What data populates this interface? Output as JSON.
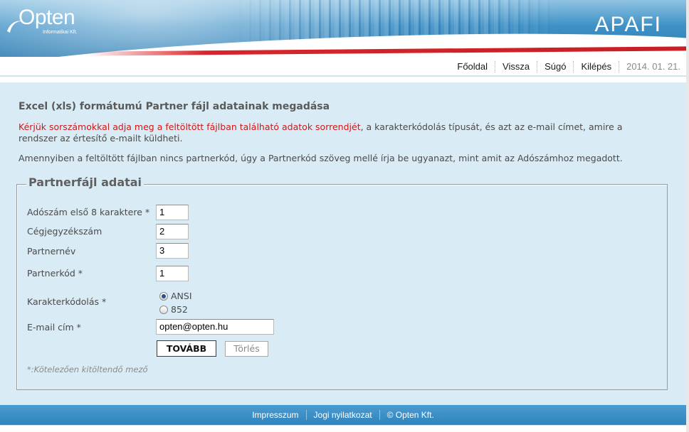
{
  "brand": {
    "logo_text": "Opten",
    "logo_subtitle": "Informatikai Kft.",
    "app_name": "APAFI"
  },
  "topnav": {
    "items": [
      {
        "label": "Főoldal"
      },
      {
        "label": "Vissza"
      },
      {
        "label": "Súgó"
      },
      {
        "label": "Kilépés"
      }
    ],
    "date": "2014. 01. 21."
  },
  "main": {
    "title": "Excel (xls) formátumú Partner fájl adatainak megadása",
    "intro_red": "Kérjük sorszámokkal adja meg a feltöltött fájlban található adatok sorrendjét",
    "intro_rest": ", a karakterkódolás típusát, és azt az e-mail címet, amire a rendszer az értesítő e-mailt küldheti.",
    "intro2": "Amennyiben a feltöltött fájlban nincs partnerkód, úgy a Partnerkód szöveg mellé írja be ugyanazt, mint amit az Adószámhoz megadott."
  },
  "form": {
    "legend": "Partnerfájl adatai",
    "fields": {
      "adoszam": {
        "label": "Adószám első 8 karaktere *",
        "value": "1"
      },
      "cegjegyzekszam": {
        "label": "Cégjegyzékszám",
        "value": "2"
      },
      "partnernev": {
        "label": "Partnernév",
        "value": "3"
      },
      "partnerkod": {
        "label": "Partnerkód *",
        "value": "1"
      },
      "karakterkodolas": {
        "label": "Karakterkódolás *",
        "options": [
          {
            "label": "ANSI",
            "checked": true
          },
          {
            "label": "852",
            "checked": false
          }
        ]
      },
      "email": {
        "label": "E-mail cím *",
        "value": "opten@opten.hu"
      }
    },
    "next_label": "TOVÁBB",
    "clear_label": "Törlés",
    "required_note": "*:Kötelezően kitöltendő mező"
  },
  "footer": {
    "items": [
      {
        "label": "Impresszum"
      },
      {
        "label": "Jogi nyilatkozat"
      },
      {
        "label": "© Opten Kft."
      }
    ]
  },
  "colors": {
    "header_blue": "#3f91c6",
    "accent_red": "#d8252b",
    "content_bg": "#d9ebf5",
    "footer_blue": "#2f84be",
    "intro_red": "#d01818"
  }
}
